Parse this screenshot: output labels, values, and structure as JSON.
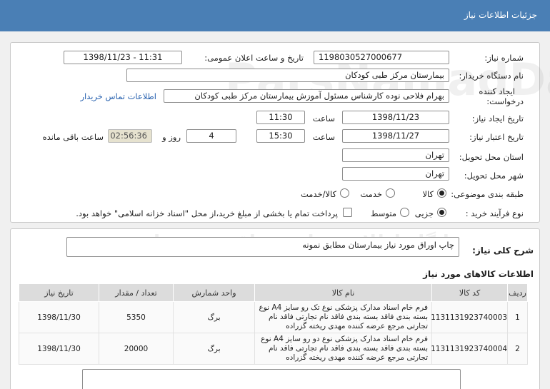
{
  "header": {
    "title": "جزئیات اطلاعات نیاز"
  },
  "form": {
    "need_number": {
      "label": "شماره نیاز:",
      "value": "1198030527000677"
    },
    "announce": {
      "label": "تاریخ و ساعت اعلان عمومی:",
      "value": "1398/11/23 - 11:31"
    },
    "buyer": {
      "label": "نام دستگاه خریدار:",
      "value": "بیمارستان مرکز طبی کودکان"
    },
    "creator": {
      "label_line1": "ایجاد کننده",
      "label_line2": "درخواست:",
      "value": "بهرام فلاحی نوده کارشناس مسئول آموزش بیمارستان مرکز طبی کودکان",
      "contact_link": "اطلاعات تماس خریدار"
    },
    "created": {
      "label": "تاریخ ایجاد نیاز:",
      "date": "1398/11/23",
      "time_label": "ساعت",
      "time": "11:30"
    },
    "validity": {
      "label": "تاریخ اعتبار نیاز:",
      "date": "1398/11/27",
      "time_label": "ساعت",
      "time": "15:30",
      "days": "4",
      "days_label": "روز و",
      "remaining": "02:56:36",
      "remaining_label": "ساعت باقی مانده"
    },
    "province": {
      "label": "استان محل تحویل:",
      "value": "تهران"
    },
    "city": {
      "label": "شهر محل تحویل:",
      "value": "تهران"
    },
    "category": {
      "label": "طبقه بندی موضوعی:",
      "options": [
        "کالا",
        "خدمت",
        "کالا/خدمت"
      ],
      "selected": "کالا"
    },
    "process": {
      "label": "نوع فرآیند خرید :",
      "options": [
        "جزیی",
        "متوسط"
      ],
      "selected": "جزیی",
      "payment_note": "پرداخت تمام یا بخشی از مبلغ خرید،از محل \"اسناد خزانه اسلامی\" خواهد بود."
    }
  },
  "summary": {
    "label": "شرح کلی نیاز:",
    "value": "چاپ اوراق مورد نیاز بیمارستان مطابق نمونه"
  },
  "goods": {
    "title": "اطلاعات کالاهای مورد نیاز",
    "columns": [
      "ردیف",
      "کد کالا",
      "نام کالا",
      "واحد شمارش",
      "تعداد / مقدار",
      "تاریخ نیاز"
    ],
    "rows": [
      {
        "row": "1",
        "code": "1131131923740003",
        "name": "فرم خام اسناد مدارک پزشکی نوع تک رو سایز A4 نوع بسته بندی فاقد بسته بندی فاقد نام تجارتی فاقد نام تجارتی مرجع عرضه کننده مهدی ریخته گزراده",
        "unit": "برگ",
        "qty": "5350",
        "date": "1398/11/30"
      },
      {
        "row": "2",
        "code": "1131131923740004",
        "name": "فرم خام اسناد مدارک پزشکی نوع دو رو سایز A4 نوع بسته بندی فاقد بسته بندی فاقد نام تجارتی فاقد نام تجارتی مرجع عرضه کننده مهدی ریخته گزراده",
        "unit": "برگ",
        "qty": "20000",
        "date": "1398/11/30"
      }
    ]
  }
}
